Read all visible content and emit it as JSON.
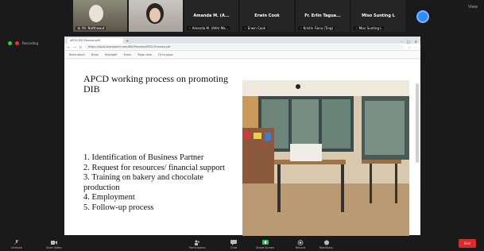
{
  "participants": [
    {
      "name": "Mr. Natthawut",
      "muted": true
    },
    {
      "name": "",
      "muted": false
    },
    {
      "name": "Amanda M. (A...",
      "sub": "Amanda M. (Ahh) Ma...",
      "muted": true
    },
    {
      "name": "Erwin Cook",
      "sub": "Erwin Cook",
      "muted": true
    },
    {
      "name": "Fr. Erlin Tagua...",
      "sub": "Kristin Fiona (Ting)",
      "muted": true
    },
    {
      "name": "Miso Sunting L",
      "sub": "Miss Sunting L",
      "muted": true
    }
  ],
  "top_right": "View",
  "left_status": "Recording",
  "browser": {
    "tab_title": "APCD DEI Process.pdf",
    "url": "https://apcd.sharepoint.com/DEI/Process/APCD-Process.pdf",
    "toolbar_items": [
      "Read aloud",
      "Draw",
      "Highlight",
      "Erase",
      "Page view",
      "Fit to page"
    ]
  },
  "slide": {
    "title": "APCD working process on promoting DIB",
    "items": [
      "1. Identification of Business Partner",
      "2. Request for resources/ financial support",
      "3. Training on bakery and chocolate production",
      "4. Employment",
      "5. Follow-up process"
    ]
  },
  "bottom_tools": [
    {
      "label": "Unmute",
      "icon": "mic-icon"
    },
    {
      "label": "Start Video",
      "icon": "video-icon"
    },
    {
      "label": "Participants",
      "icon": "participants-icon"
    },
    {
      "label": "Chat",
      "icon": "chat-icon"
    },
    {
      "label": "Share Screen",
      "icon": "share-screen-icon",
      "color": "#26c24b"
    },
    {
      "label": "Record",
      "icon": "record-icon"
    },
    {
      "label": "Reactions",
      "icon": "reactions-icon"
    }
  ],
  "end_label": "End"
}
